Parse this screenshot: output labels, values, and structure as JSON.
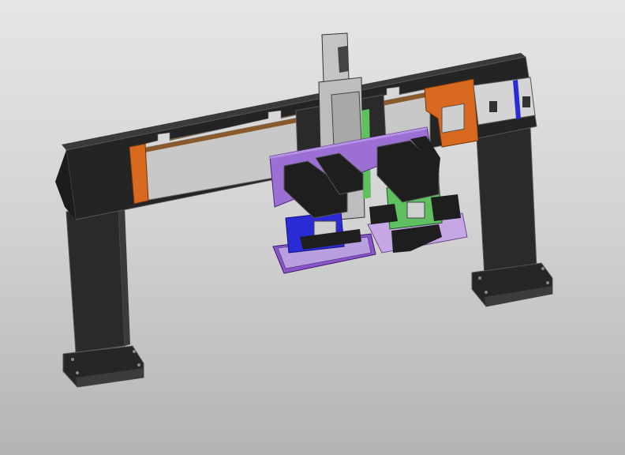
{
  "viewport": {
    "background_top": "#e6e6e6",
    "background_bottom": "#b4b4b4"
  },
  "model": {
    "colors": {
      "frame": "#262626",
      "frame_edge": "#555555",
      "rail": "#c8c8c8",
      "end_plate": "#d9691f",
      "column": "#bdbdbd",
      "mount_plate": "#9b6fd3",
      "gripper_left": "#2b2bd6",
      "tray_left": "#8a55c8",
      "gripper_right": "#5fc05f",
      "tray_right": "#c7a6e6",
      "bracket": "#1e1e1e"
    }
  }
}
